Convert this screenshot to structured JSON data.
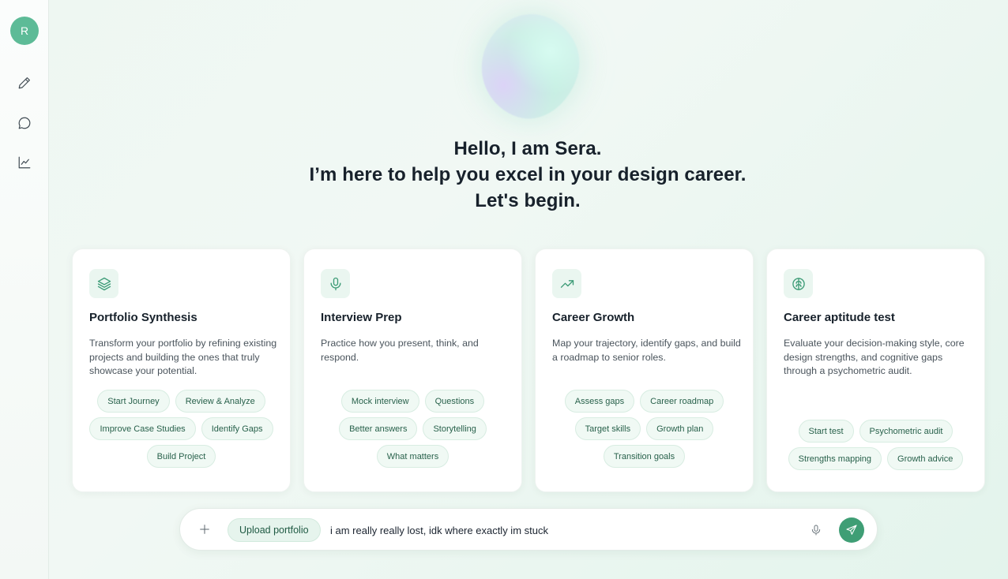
{
  "user": {
    "avatar_initial": "R"
  },
  "sidebar": {
    "items": [
      {
        "icon": "pencil-icon"
      },
      {
        "icon": "chat-bubble-icon"
      },
      {
        "icon": "line-chart-icon"
      }
    ]
  },
  "hero": {
    "line1": "Hello, I am Sera.",
    "line2": "I’m here to help you excel in your design career.",
    "line3": "Let's begin."
  },
  "cards": [
    {
      "icon": "layers-icon",
      "title": "Portfolio Synthesis",
      "description": "Transform your portfolio by refining existing projects and building the ones that truly showcase your potential.",
      "chips": [
        "Start Journey",
        "Review & Analyze",
        "Improve Case Studies",
        "Identify Gaps",
        "Build Project"
      ]
    },
    {
      "icon": "microphone-icon",
      "title": "Interview Prep",
      "description": "Practice how you present, think, and respond.",
      "chips": [
        "Mock interview",
        "Questions",
        "Better answers",
        "Storytelling",
        "What matters"
      ]
    },
    {
      "icon": "trending-up-icon",
      "title": "Career Growth",
      "description": "Map your trajectory, identify gaps, and build a roadmap to senior roles.",
      "chips": [
        "Assess gaps",
        "Career roadmap",
        "Target skills",
        "Growth plan",
        "Transition goals"
      ]
    },
    {
      "icon": "brain-icon",
      "title": "Career aptitude test",
      "description": "Evaluate your decision-making style, core design strengths, and cognitive gaps through a psychometric audit.",
      "chips": [
        "Start test",
        "Psychometric audit",
        "Strengths mapping",
        "Growth advice"
      ]
    }
  ],
  "composer": {
    "upload_label": "Upload portfolio",
    "message_value": "i am really really lost, idk where exactly im stuck"
  },
  "colors": {
    "accent": "#3f9e75",
    "avatar": "#5dbb97",
    "chip_bg": "#f0f9f4"
  }
}
